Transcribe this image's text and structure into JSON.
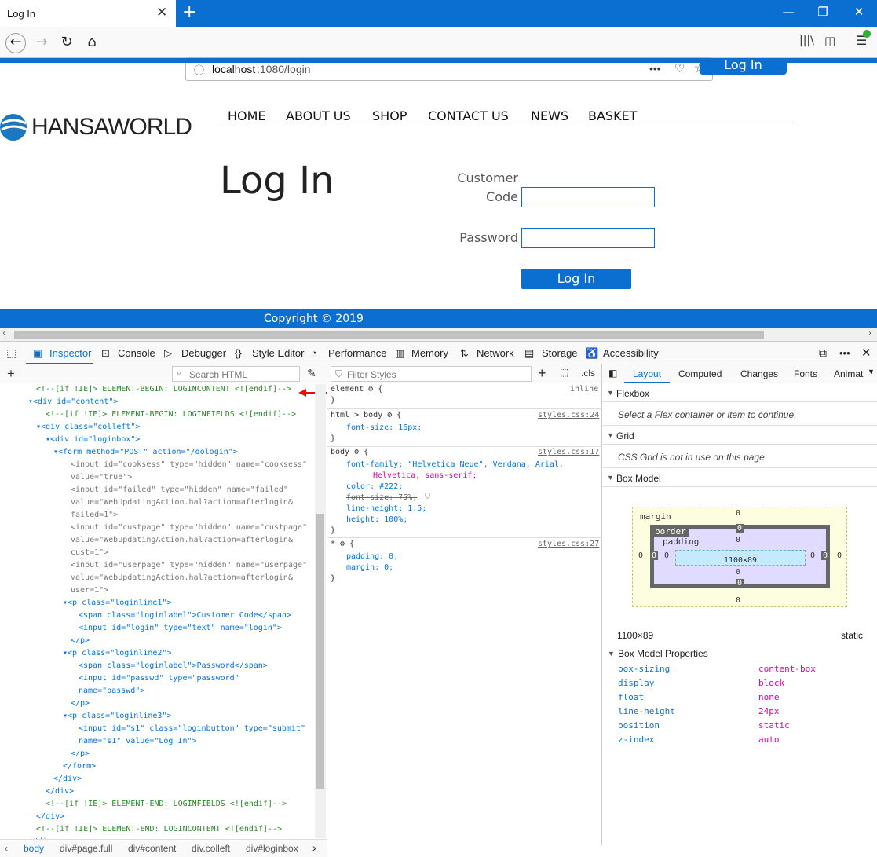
{
  "browser": {
    "tab_title": "Log In",
    "tab_close": "✕",
    "new_tab": "+",
    "url_host": "localhost",
    "url_path": ":1080/login",
    "url_info_icon": "info-icon",
    "page_actions": "•••"
  },
  "page": {
    "top_login": "Log In",
    "logo_text": "HANSAWORLD",
    "menu": [
      "HOME",
      "ABOUT US",
      "SHOP",
      "CONTACT US",
      "NEWS",
      "BASKET"
    ],
    "heading": "Log In",
    "customer_label_1": "Customer",
    "customer_label_2": "Code",
    "password_label": "Password",
    "login_button": "Log In",
    "footer": "Copyright © 2019"
  },
  "devtools": {
    "tabs": [
      "Inspector",
      "Console",
      "Debugger",
      "Style Editor",
      "Performance",
      "Memory",
      "Network",
      "Storage",
      "Accessibility"
    ],
    "search_html_placeholder": "Search HTML",
    "filter_styles_placeholder": "Filter Styles",
    "cls_label": ".cls",
    "layout_tabs": [
      "Layout",
      "Computed",
      "Changes",
      "Fonts",
      "Animat"
    ],
    "html_lines": [
      {
        "indent": 46,
        "kind": "cm",
        "text": "<!--[if !IE]> ELEMENT-BEGIN: LOGINCONTENT <![endif]-->"
      },
      {
        "indent": 36,
        "kind": "el",
        "text": "▾<div id=\"content\">"
      },
      {
        "indent": 58,
        "kind": "cm",
        "text": "<!--[if !IE]> ELEMENT-BEGIN: LOGINFIELDS <![endif]-->"
      },
      {
        "indent": 46,
        "kind": "el",
        "text": "▾<div class=\"colleft\">"
      },
      {
        "indent": 58,
        "kind": "el",
        "text": "▾<div id=\"loginbox\">"
      },
      {
        "indent": 68,
        "kind": "el",
        "text": "▾<form method=\"POST\" action=\"/dologin\">"
      },
      {
        "indent": 90,
        "kind": "dim",
        "text": "<input id=\"cooksess\" type=\"hidden\" name=\"cooksess\""
      },
      {
        "indent": 90,
        "kind": "dim",
        "text": "value=\"true\">"
      },
      {
        "indent": 90,
        "kind": "dim",
        "text": "<input id=\"failed\" type=\"hidden\" name=\"failed\""
      },
      {
        "indent": 90,
        "kind": "dim",
        "text": "value=\"WebUpdatingAction.hal?action=afterlogin&"
      },
      {
        "indent": 90,
        "kind": "dim",
        "text": "failed=1\">"
      },
      {
        "indent": 90,
        "kind": "dim",
        "text": "<input id=\"custpage\" type=\"hidden\" name=\"custpage\""
      },
      {
        "indent": 90,
        "kind": "dim",
        "text": "value=\"WebUpdatingAction.hal?action=afterlogin&"
      },
      {
        "indent": 90,
        "kind": "dim",
        "text": "cust=1\">"
      },
      {
        "indent": 90,
        "kind": "dim",
        "text": "<input id=\"userpage\" type=\"hidden\" name=\"userpage\""
      },
      {
        "indent": 90,
        "kind": "dim",
        "text": "value=\"WebUpdatingAction.hal?action=afterlogin&"
      },
      {
        "indent": 90,
        "kind": "dim",
        "text": "user=1\">"
      },
      {
        "indent": 80,
        "kind": "el",
        "text": "▾<p class=\"loginline1\">"
      },
      {
        "indent": 100,
        "kind": "el",
        "text": "<span class=\"loginlabel\">Customer Code</span>"
      },
      {
        "indent": 100,
        "kind": "el",
        "text": "<input id=\"login\" type=\"text\" name=\"login\">"
      },
      {
        "indent": 90,
        "kind": "el",
        "text": "</p>"
      },
      {
        "indent": 80,
        "kind": "el",
        "text": "▾<p class=\"loginline2\">"
      },
      {
        "indent": 100,
        "kind": "el",
        "text": "<span class=\"loginlabel\">Password</span>"
      },
      {
        "indent": 100,
        "kind": "el",
        "text": "<input id=\"passwd\" type=\"password\""
      },
      {
        "indent": 100,
        "kind": "el",
        "text": "name=\"passwd\">"
      },
      {
        "indent": 90,
        "kind": "el",
        "text": "</p>"
      },
      {
        "indent": 80,
        "kind": "el",
        "text": "▾<p class=\"loginline3\">"
      },
      {
        "indent": 100,
        "kind": "el",
        "text": "<input id=\"s1\" class=\"loginbutton\" type=\"submit\""
      },
      {
        "indent": 100,
        "kind": "el",
        "text": "name=\"s1\" value=\"Log In\">"
      },
      {
        "indent": 90,
        "kind": "el",
        "text": "</p>"
      },
      {
        "indent": 80,
        "kind": "el",
        "text": "</form>"
      },
      {
        "indent": 68,
        "kind": "el",
        "text": "</div>"
      },
      {
        "indent": 58,
        "kind": "el",
        "text": "</div>"
      },
      {
        "indent": 58,
        "kind": "cm",
        "text": "<!--[if !IE]> ELEMENT-END: LOGINFIELDS <![endif]-->"
      },
      {
        "indent": 46,
        "kind": "el",
        "text": "</div>"
      },
      {
        "indent": 46,
        "kind": "cm",
        "text": "<!--[if !IE]> ELEMENT-END: LOGINCONTENT <![endif]-->"
      },
      {
        "indent": 36,
        "kind": "el",
        "text": "</div>"
      }
    ],
    "rules": {
      "element_selector": "element",
      "element_inline": "inline",
      "body1_selector": "html > body",
      "body1_source": "styles.css:24",
      "body1_decl": "font-size: 16px;",
      "body2_selector": "body",
      "body2_source": "styles.css:17",
      "body2_decl_1": "font-family: \"Helvetica Neue\", Verdana, Arial,",
      "body2_decl_1b": "Helvetica, sans-serif;",
      "body2_decl_2": "color: #222;",
      "body2_decl_3": "font-size: 75%;",
      "body2_decl_4": "line-height: 1.5;",
      "body2_decl_5": "height: 100%;",
      "star_selector": "*",
      "star_source": "styles.css:27",
      "star_decl_1": "padding: 0;",
      "star_decl_2": "margin: 0;"
    },
    "layout": {
      "flexbox_title": "Flexbox",
      "flexbox_note": "Select a Flex container or item to continue.",
      "grid_title": "Grid",
      "grid_note": "CSS Grid is not in use on this page",
      "boxmodel_title": "Box Model",
      "margin_label": "margin",
      "border_label": "border",
      "padding_label": "padding",
      "content_size": "1100×89",
      "zero": "0",
      "size_text": "1100×89",
      "position_text": "static",
      "props_title": "Box Model Properties",
      "props": [
        {
          "name": "box-sizing",
          "value": "content-box"
        },
        {
          "name": "display",
          "value": "block"
        },
        {
          "name": "float",
          "value": "none"
        },
        {
          "name": "line-height",
          "value": "24px"
        },
        {
          "name": "position",
          "value": "static"
        },
        {
          "name": "z-index",
          "value": "auto"
        }
      ]
    },
    "breadcrumbs": [
      "body",
      "div#page.full",
      "div#content",
      "div.colleft",
      "div#loginbox"
    ]
  }
}
